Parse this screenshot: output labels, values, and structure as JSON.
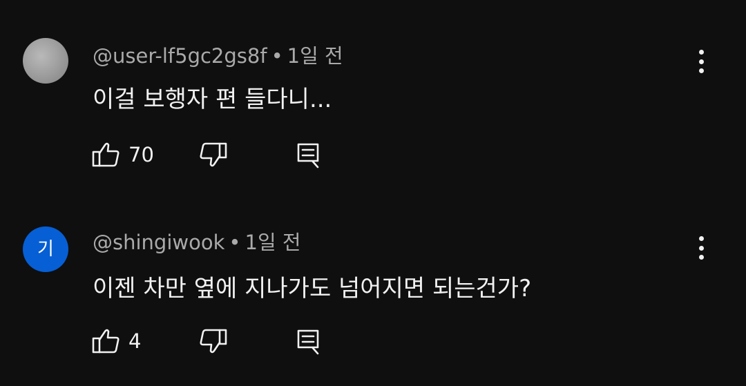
{
  "comments": [
    {
      "author": "@user-lf5gc2gs8f",
      "separator": "•",
      "time": "1일 전",
      "text": "이걸 보행자 편 들다니...",
      "likes": "70",
      "avatar_letter": "",
      "avatar_color": "#9c9c9c"
    },
    {
      "author": "@shingiwook",
      "separator": "•",
      "time": "1일 전",
      "text": "이젠 차만 옆에 지나가도 넘어지면 되는건가?",
      "likes": "4",
      "avatar_letter": "기",
      "avatar_color": "#065fd4"
    }
  ],
  "icons": {
    "like": "thumb-up-icon",
    "dislike": "thumb-down-icon",
    "reply": "reply-icon",
    "more": "more-vertical-icon"
  },
  "colors": {
    "background": "#0f0f0f",
    "primary_text": "#f1f1f1",
    "secondary_text": "#aaaaaa"
  }
}
